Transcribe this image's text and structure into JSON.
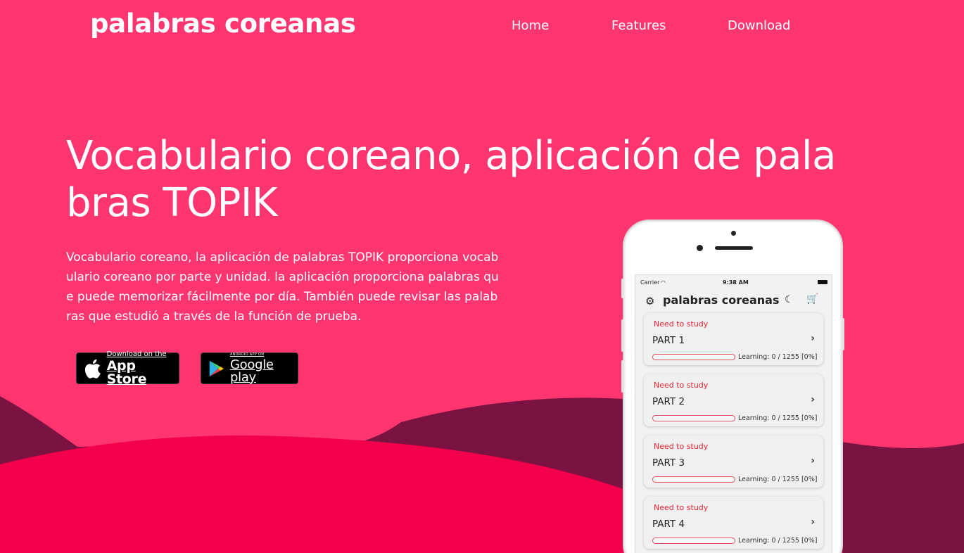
{
  "brand": "palabras coreanas",
  "nav": {
    "home": "Home",
    "features": "Features",
    "download": "Download"
  },
  "hero": {
    "title": "Vocabulario coreano, aplicación de palabras TOPIK",
    "description": "Vocabulario coreano, la aplicación de palabras TOPIK proporciona vocabulario coreano por parte y unidad. la aplicación proporciona palabras que puede memorizar fácilmente por día. También puede revisar las palabras que estudió a través de la función de prueba."
  },
  "badges": {
    "apple": {
      "small": "Download on the",
      "big": "App Store",
      "icon": "apple-logo-icon"
    },
    "google": {
      "small": "ANDROID APP ON",
      "big": "Google play",
      "icon": "google-play-logo-icon"
    }
  },
  "phone": {
    "status": {
      "carrier": "Carrier",
      "time": "9:38 AM"
    },
    "app_title": "palabras coreanas",
    "icons": {
      "settings": "gear-icon",
      "theme": "moon-icon",
      "store": "cart-icon"
    },
    "cards": [
      {
        "status": "Need to study",
        "title": "PART 1",
        "progress": 0,
        "learning": "Learning: 0 / 1255 [0%]"
      },
      {
        "status": "Need to study",
        "title": "PART 2",
        "progress": 0,
        "learning": "Learning: 0 / 1255 [0%]"
      },
      {
        "status": "Need to study",
        "title": "PART 3",
        "progress": 0,
        "learning": "Learning: 0 / 1255 [0%]"
      },
      {
        "status": "Need to study",
        "title": "PART 4",
        "progress": 0,
        "learning": "Learning: 0 / 1255 [0%]"
      }
    ]
  },
  "colors": {
    "background": "#ff3570",
    "wave_dark": "#7a1242",
    "wave_bright": "#f2004c",
    "accent_red": "#e02433"
  }
}
